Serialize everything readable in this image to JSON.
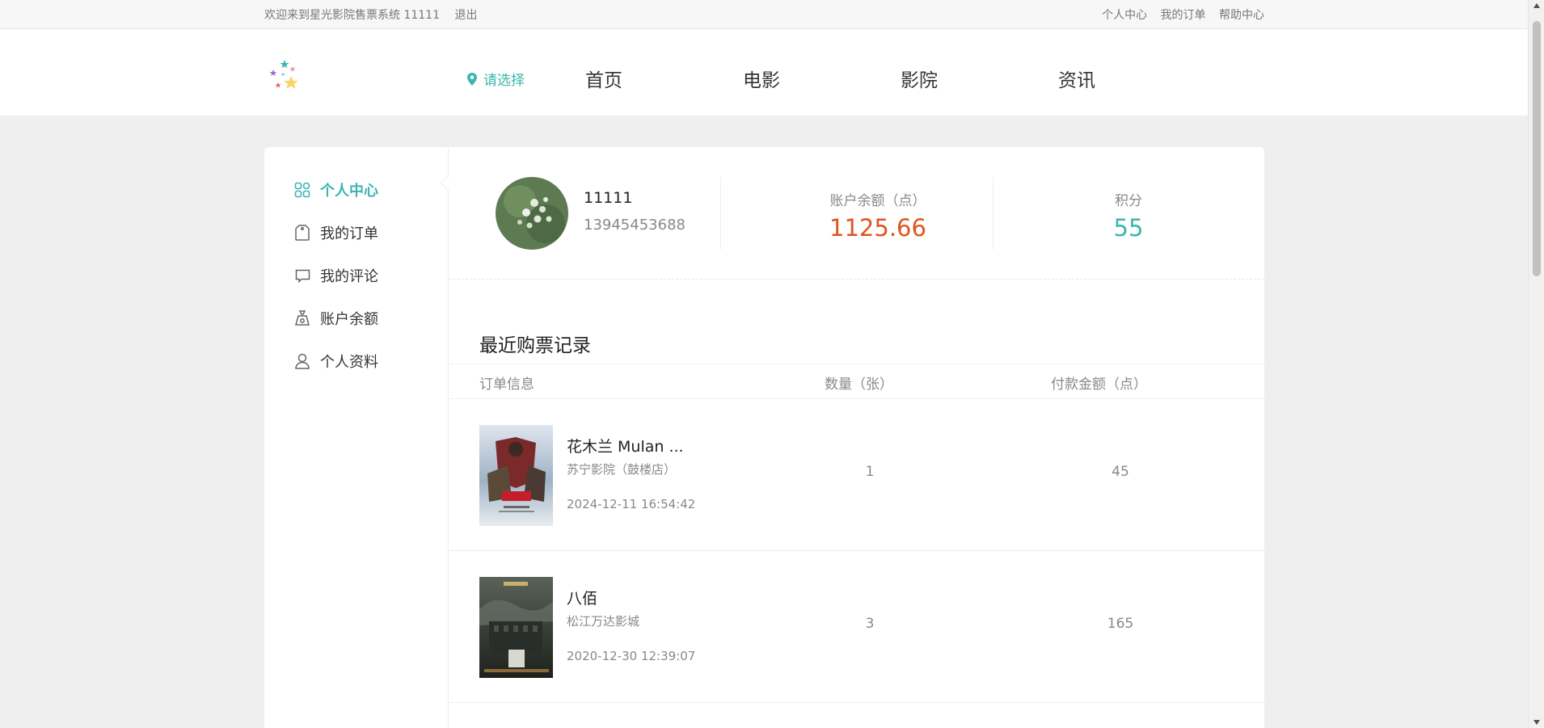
{
  "topbar": {
    "welcome": "欢迎来到星光影院售票系统 11111",
    "logout": "退出",
    "links": [
      "个人中心",
      "我的订单",
      "帮助中心"
    ]
  },
  "header": {
    "city": "请选择",
    "nav": [
      "首页",
      "电影",
      "影院",
      "资讯"
    ]
  },
  "sidebar": {
    "items": [
      {
        "label": "个人中心",
        "icon": "grid-icon",
        "active": true
      },
      {
        "label": "我的订单",
        "icon": "bag-icon"
      },
      {
        "label": "我的评论",
        "icon": "comment-icon"
      },
      {
        "label": "账户余额",
        "icon": "wallet-icon"
      },
      {
        "label": "个人资料",
        "icon": "user-icon"
      }
    ]
  },
  "profile": {
    "username": "11111",
    "phone": "13945453688",
    "balance_label": "账户余额（点）",
    "balance": "1125.66",
    "points_label": "积分",
    "points": "55"
  },
  "records": {
    "title": "最近购票记录",
    "headers": [
      "订单信息",
      "数量（张）",
      "付款金额（点）"
    ],
    "rows": [
      {
        "movie": "花木兰 Mulan ...",
        "cinema": "苏宁影院（鼓楼店）",
        "time": "2024-12-11 16:54:42",
        "qty": "1",
        "amount": "45"
      },
      {
        "movie": "八佰",
        "cinema": "松江万达影城",
        "time": "2020-12-30 12:39:07",
        "qty": "3",
        "amount": "165"
      }
    ]
  },
  "colors": {
    "accent": "#3ab5b0",
    "balance": "#e0541f"
  }
}
